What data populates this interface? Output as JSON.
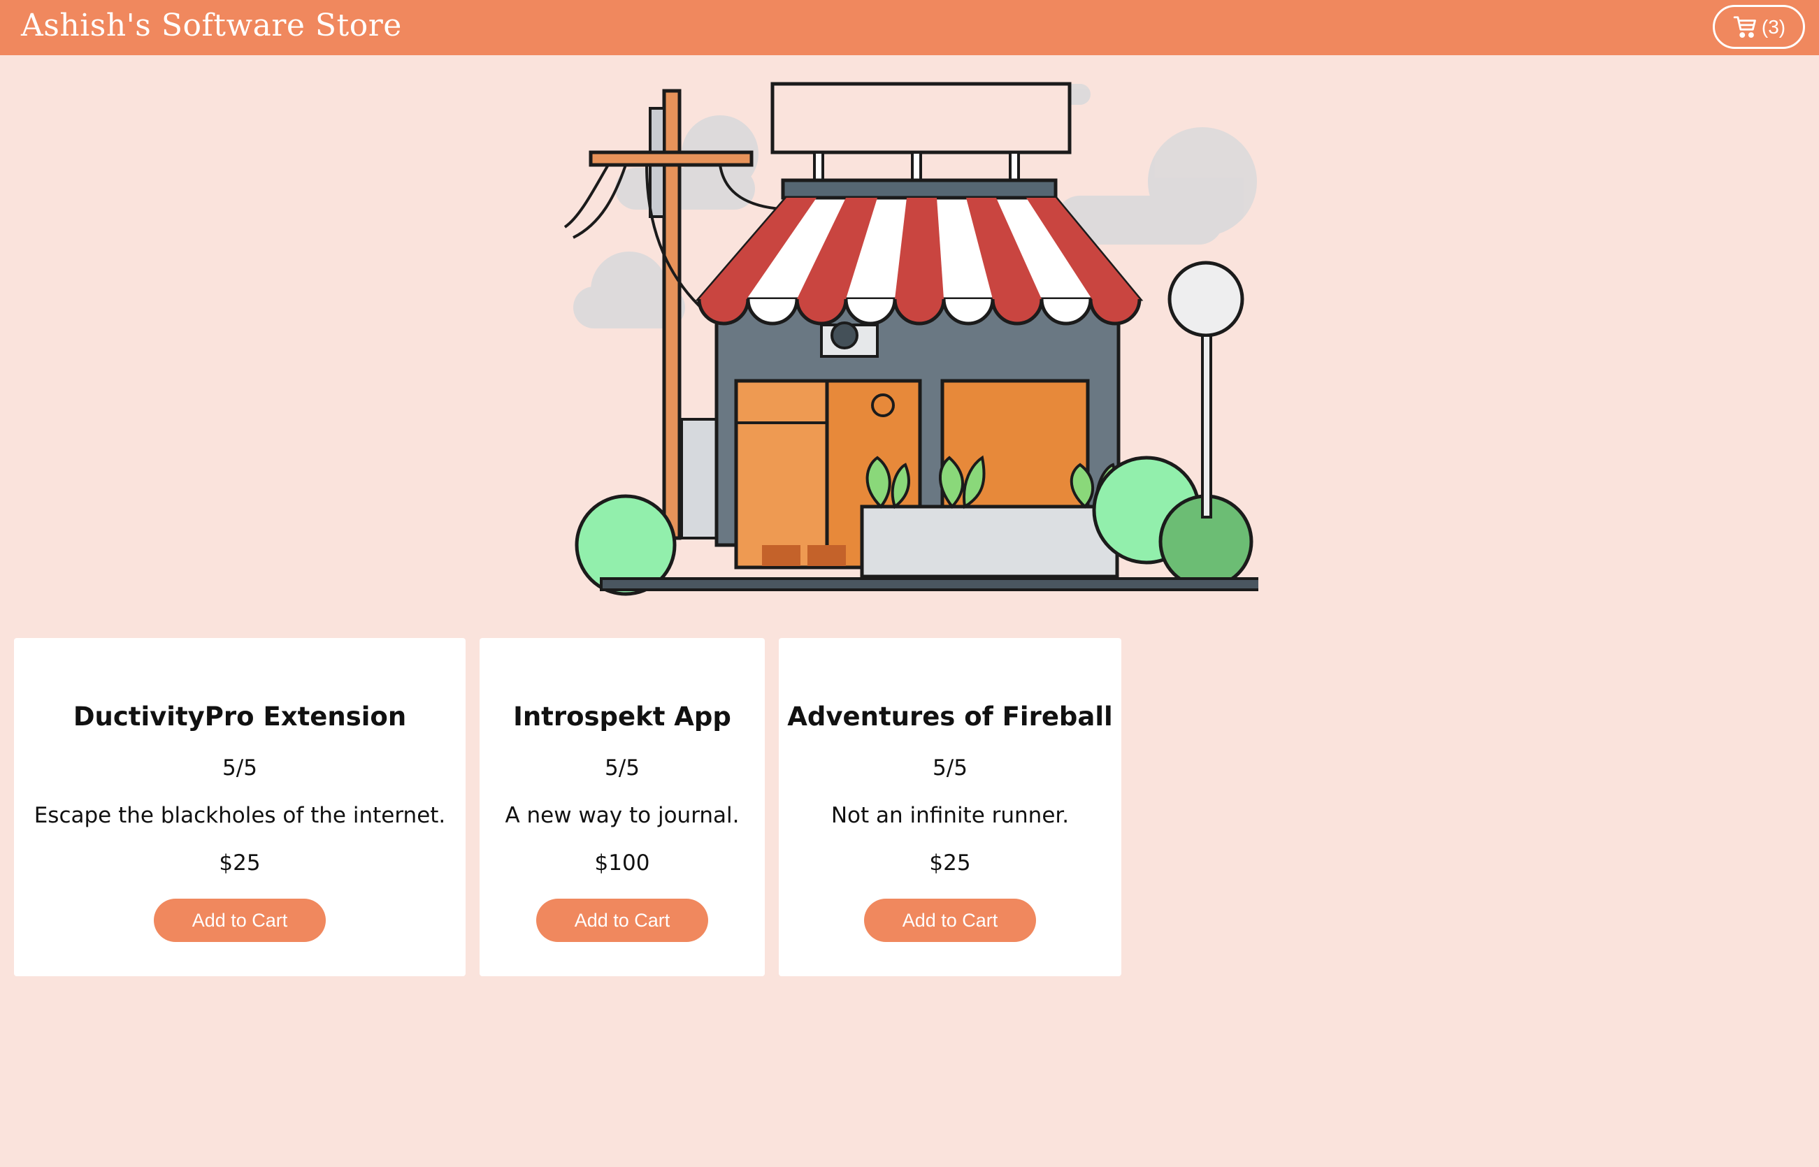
{
  "header": {
    "title": "Ashish's Software Store",
    "cart_icon": "shopping-cart-icon",
    "cart_count": "(3)"
  },
  "hero": {
    "illustration": "storefront-illustration"
  },
  "products": [
    {
      "title": "DuctivityPro Extension",
      "rating": "5/5",
      "description": "Escape the blackholes of the internet.",
      "price": "$25",
      "button": "Add to Cart"
    },
    {
      "title": "Introspekt App",
      "rating": "5/5",
      "description": "A new way to journal.",
      "price": "$100",
      "button": "Add to Cart"
    },
    {
      "title": "Adventures of Fireball",
      "rating": "5/5",
      "description": "Not an infinite runner.",
      "price": "$25",
      "button": "Add to Cart"
    }
  ],
  "colors": {
    "accent": "#f0885e",
    "background": "#fae3dc",
    "card": "#ffffff"
  }
}
